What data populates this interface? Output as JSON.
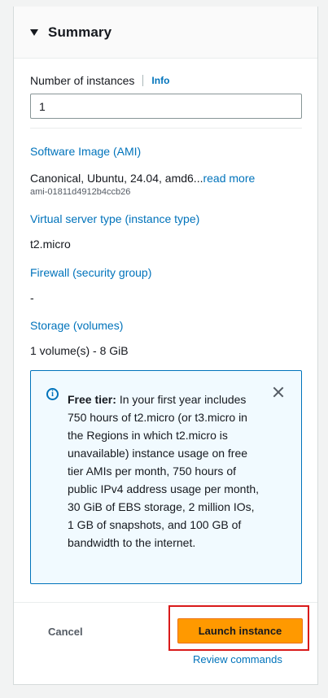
{
  "summary": {
    "title": "Summary",
    "number_of_instances": {
      "label": "Number of instances",
      "info_label": "Info",
      "value": "1"
    },
    "ami": {
      "title": "Software Image (AMI)",
      "value": "Canonical, Ubuntu, 24.04, amd6...",
      "read_more": "read more",
      "id": "ami-01811d4912b4ccb26"
    },
    "instance_type": {
      "title": "Virtual server type (instance type)",
      "value": "t2.micro"
    },
    "firewall": {
      "title": "Firewall (security group)",
      "value": "-"
    },
    "storage": {
      "title": "Storage (volumes)",
      "value": "1 volume(s) - 8 GiB"
    },
    "free_tier": {
      "label": "Free tier:",
      "text": "In your first year includes 750 hours of t2.micro (or t3.micro in the Regions in which t2.micro is unavailable) instance usage on free tier AMIs per month, 750 hours of public IPv4 address usage per month, 30 GiB of EBS storage, 2 million IOs, 1 GB of snapshots, and 100 GB of bandwidth to the internet."
    },
    "actions": {
      "cancel": "Cancel",
      "launch": "Launch instance",
      "review": "Review commands"
    }
  },
  "colors": {
    "link": "#0073bb",
    "primary_button": "#ff9900",
    "highlight": "#d91a1a"
  }
}
